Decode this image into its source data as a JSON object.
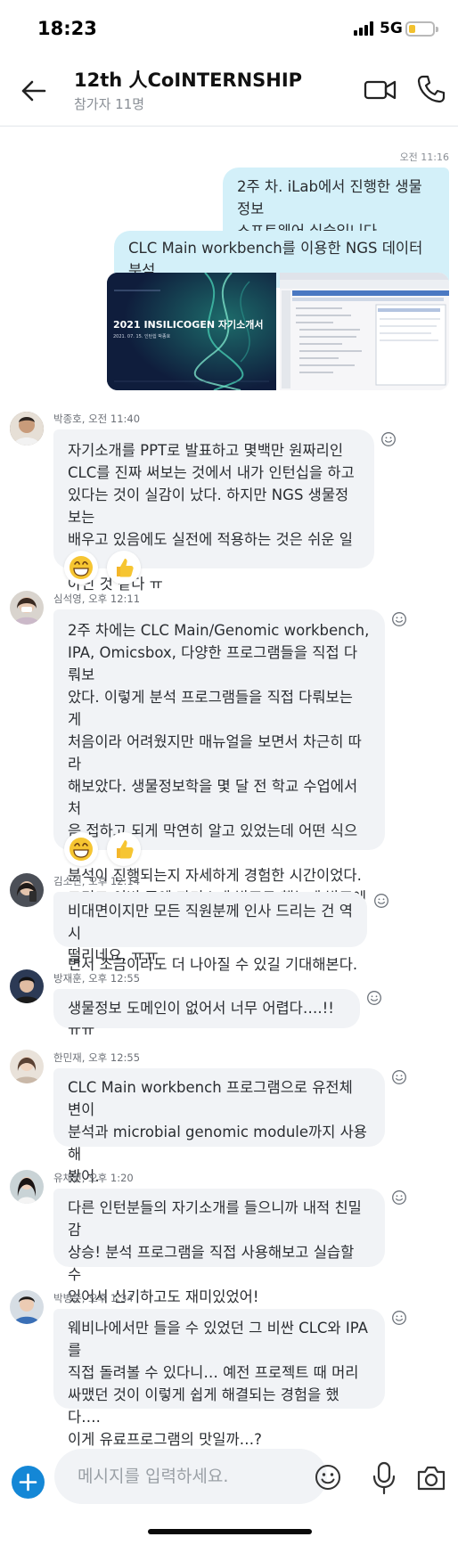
{
  "status_bar": {
    "time": "18:23",
    "network": "5G"
  },
  "header": {
    "title": "12th 人CoINTERNSHIP",
    "subtitle": "참가자 11명"
  },
  "own": {
    "time": "오전 11:16",
    "messages": [
      "2주 차. iLab에서 진행한 생물정보\n소프트웨어 실습입니다.",
      "CLC Main workbench를 이용한 NGS 데이터 분석"
    ],
    "slide_title": "2021 INSILICOGEN 자기소개서",
    "slide_sub": "2021. 07. 15. 인턴쉽 박종호"
  },
  "messages": [
    {
      "name": "박종호",
      "time": "오전 11:40",
      "text": "자기소개를 PPT로 발표하고 몇백만 원짜리인\nCLC를 진짜 써보는 것에서 내가 인턴십을 하고\n있다는 것이 실감이 났다. 하지만 NGS 생물정보는\n배우고 있음에도 실전에 적용하는 것은 쉬운 일이\n아닌 것 같다 ㅠ"
    },
    {
      "name": "심석영",
      "time": "오후 12:11",
      "text": "2주 차에는 CLC Main/Genomic workbench,\nIPA, Omicsbox, 다양한 프로그램들을 직접 다뤄보\n았다. 이렇게 분석 프로그램들을 직접 다뤄보는 게\n처음이라 어려웠지만 매뉴얼을 보면서 차근히 따라\n해보았다. 생물정보학을 몇 달 전 학교 수업에서 처\n음 접하고 되게 막연히 알고 있었는데 어떤 식으로\n분석이 진행되는지 자세하게 경험한 시간이었다.\n그리고 이번 주엔 자기소개 발표도 했는데 발표에\n아직 익숙해지지 않은 것 같다. 인턴십 과정을 거치\n면서 조금이라도 더 나아질 수 있길 기대해본다."
    },
    {
      "name": "김소연",
      "time": "오후 12:14",
      "text": "비대면이지만 모든 직원분께 인사 드리는 건 역시\n떨리네요. ㅠㅠ"
    },
    {
      "name": "방재훈",
      "time": "오후 12:55",
      "text": "생물정보 도메인이 없어서 너무 어렵다….!! ㅠㅠ"
    },
    {
      "name": "한민재",
      "time": "오후 12:55",
      "text": "CLC Main workbench 프로그램으로 유전체 변이\n분석과 microbial genomic module까지 사용 해\n봤어."
    },
    {
      "name": "유채민",
      "time": "오후 1:20",
      "text": "다른 인턴분들의 자기소개를 들으니까 내적 친밀감\n상승! 분석 프로그램을 직접 사용해보고 실습할 수\n있어서 신기하고도 재미있었어!"
    },
    {
      "name": "박병준",
      "time": "오후 1:34",
      "text": "웨비나에서만 들을 수 있었던 그 비싼 CLC와 IPA를\n직접 돌려볼 수 있다니… 예전 프로젝트 때 머리\n싸맸던 것이 이렇게 쉽게 해결되는 경험을 했다….\n이게 유료프로그램의 맛일까…?"
    }
  ],
  "reactions": [
    "grinning-face",
    "thumbs-up"
  ],
  "input": {
    "placeholder": "메시지를 입력하세요."
  },
  "colors": {
    "accent": "#1487d6",
    "own_bubble": "#d3f0f9",
    "other_bubble": "#f1f3f6"
  }
}
